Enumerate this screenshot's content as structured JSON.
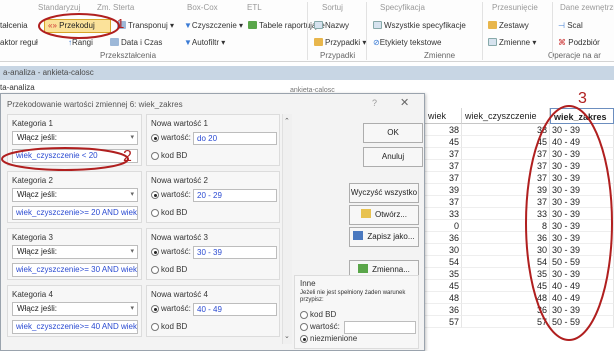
{
  "ribbon": {
    "row1": {
      "standaryzuj": "Standaryzuj",
      "zmiennestatystyki": "Zm. Sterta",
      "boxcox": "Box-Cox",
      "etl": "ETL",
      "sortuj": "Sortuj",
      "specyfikacja": "Specyfikacja",
      "przesuniecie": "Przesunięcie",
      "dane_zewn": "Dane zewnętrzne"
    },
    "talcenia": "tałcenia",
    "recode": "Przekoduj",
    "transponuj": "Transponuj",
    "czyszczenie": "Czyszczenie",
    "tabele": "Tabele raportujące",
    "nazwy": "Nazwy",
    "wszystkie_spec": "Wszystkie specyfikacje",
    "zestawy": "Zestawy",
    "scal": "Scal",
    "aktor": "aktor reguł",
    "rangi": "Rangi",
    "data_czas": "Data i Czas",
    "autofiltr": "Autofiltr",
    "przypadki": "Przypadki",
    "etykiety": "Etykiety tekstowe",
    "zmienne": "Zmienne",
    "podzbior": "Podzbiór",
    "groups": {
      "przeksztalcenia": "Przekształcenia",
      "przypadki": "Przypadki",
      "zmienne": "Zmienne",
      "operacje": "Operacje na ar"
    }
  },
  "background": {
    "tab_title": "a-analiza - ankieta-calosc",
    "pane_title": "ta-analiza",
    "sheet_tab": "ankieta-calosc"
  },
  "grid": {
    "headers": [
      "wiek",
      "wiek_czyszczenie",
      "wiek_zakres"
    ],
    "rows": [
      [
        "38",
        "38",
        "30 - 39"
      ],
      [
        "45",
        "45",
        "40 - 49"
      ],
      [
        "37",
        "37",
        "30 - 39"
      ],
      [
        "37",
        "37",
        "30 - 39"
      ],
      [
        "37",
        "37",
        "30 - 39"
      ],
      [
        "39",
        "39",
        "30 - 39"
      ],
      [
        "37",
        "37",
        "30 - 39"
      ],
      [
        "33",
        "33",
        "30 - 39"
      ],
      [
        "0",
        "8",
        "30 - 39"
      ],
      [
        "36",
        "36",
        "30 - 39"
      ],
      [
        "30",
        "30",
        "30 - 39"
      ],
      [
        "54",
        "54",
        "50 - 59"
      ],
      [
        "35",
        "35",
        "30 - 39"
      ],
      [
        "45",
        "45",
        "40 - 49"
      ],
      [
        "48",
        "48",
        "40 - 49"
      ],
      [
        "36",
        "36",
        "30 - 39"
      ],
      [
        "57",
        "57",
        "50 - 59"
      ]
    ]
  },
  "dialog": {
    "title": "Przekodowanie wartości zmiennej 6: wiek_zakres",
    "help": "?",
    "close": "✕",
    "categories": [
      {
        "label": "Kategoria 1",
        "include": "Włącz jeśli:",
        "condition": "wiek_czyszczenie < 20",
        "new_label": "Nowa wartość 1",
        "value_label": "wartość:",
        "value": "do 20",
        "bd": "kod BD"
      },
      {
        "label": "Kategoria 2",
        "include": "Włącz jeśli:",
        "condition": "wiek_czyszczenie>= 20 AND wiek_",
        "new_label": "Nowa wartość 2",
        "value_label": "wartość:",
        "value": "20 - 29",
        "bd": "kod BD"
      },
      {
        "label": "Kategoria 3",
        "include": "Włącz jeśli:",
        "condition": "wiek_czyszczenie>= 30 AND wiek_",
        "new_label": "Nowa wartość 3",
        "value_label": "wartość:",
        "value": "30 - 39",
        "bd": "kod BD"
      },
      {
        "label": "Kategoria 4",
        "include": "Włącz jeśli:",
        "condition": "wiek_czyszczenie>= 40 AND wiek_",
        "new_label": "Nowa wartość 4",
        "value_label": "wartość:",
        "value": "40 - 49",
        "bd": "kod BD"
      }
    ],
    "buttons": {
      "ok": "OK",
      "cancel": "Anuluj",
      "clear": "Wyczyść wszystko",
      "open": "Otwórz...",
      "save": "Zapisz jako...",
      "vars": "Zmienna..."
    },
    "other": {
      "title": "Inne",
      "desc": "Jeżeli nie jest spełniony żaden warunek przypisz:",
      "bd": "kod BD",
      "value_label": "wartość:",
      "unchanged": "niezmienione"
    }
  },
  "annotations": {
    "one": "1",
    "two": "2",
    "three": "3"
  },
  "colors": {
    "accent": "#b01f1f",
    "highlight": "#fbe29a",
    "condition_text": "#2b4bd2"
  }
}
